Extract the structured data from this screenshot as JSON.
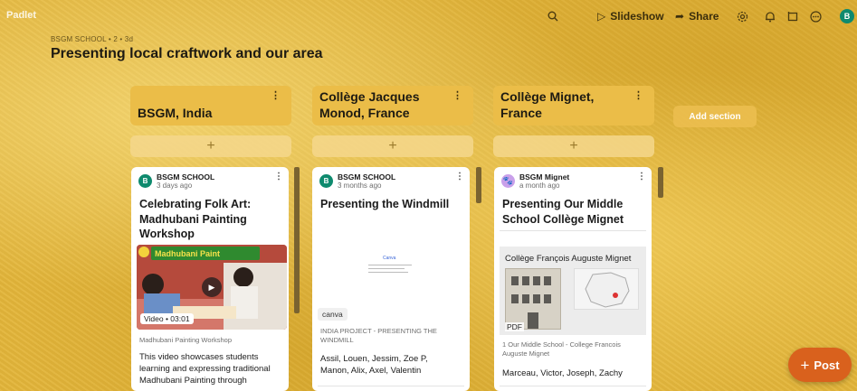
{
  "app": {
    "name": "Padlet"
  },
  "topbar": {
    "search_icon": "search-icon",
    "slideshow_label": "Slideshow",
    "share_label": "Share",
    "user_initial": "B"
  },
  "board": {
    "breadcrumb": "BSGM SCHOOL • 2 • 3d",
    "title": "Presenting local craftwork and our area",
    "add_section_label": "Add section"
  },
  "sections": [
    {
      "title_lines": [
        "BSGM, India"
      ],
      "post": {
        "author": "BSGM SCHOOL",
        "avatar": "B",
        "time": "3 days ago",
        "title_lines": [
          "Celebrating Folk Art:",
          "Madhubani Painting",
          "Workshop"
        ],
        "media_banner": "Madhubani Paint",
        "media_label": "Video • 03:01",
        "caption": "Madhubani Painting Workshop",
        "body_lines": [
          "This video showcases students",
          "learning and expressing traditional",
          "Madhubani Painting through"
        ]
      }
    },
    {
      "title_lines": [
        "Collège Jacques",
        "Monod, France"
      ],
      "post": {
        "author": "BSGM SCHOOL",
        "avatar": "B",
        "time": "3 months ago",
        "title_lines": [
          "Presenting the Windmill"
        ],
        "media_thumb_logo": "Canva",
        "chip": "canva",
        "caption_lines": [
          "INDIA PROJECT - PRESENTING THE",
          "WINDMILL"
        ],
        "body_lines": [
          "Assil, Louen, Jessim, Zoe P,",
          "Manon, Alix, Axel, Valentin"
        ]
      }
    },
    {
      "title_lines": [
        "Collège Mignet,",
        "France"
      ],
      "post": {
        "author": "BSGM Mignet",
        "avatar": "🐾",
        "time": "a month ago",
        "title_lines": [
          "Presenting Our Middle",
          "School Collège Mignet"
        ],
        "media_title": "Collège François Auguste Mignet",
        "media_badge": "PDF",
        "caption_lines": [
          "1 Our Middle School - College Francois",
          "Auguste Mignet"
        ],
        "body_lines": [
          "Marceau, Victor, Joseph, Zachy"
        ]
      }
    }
  ],
  "fab": {
    "label": "Post"
  },
  "colors": {
    "background": "#e3b53a",
    "section_header": "#ebbd48",
    "fab": "#d9611d",
    "avatar": "#0e8a6e"
  }
}
